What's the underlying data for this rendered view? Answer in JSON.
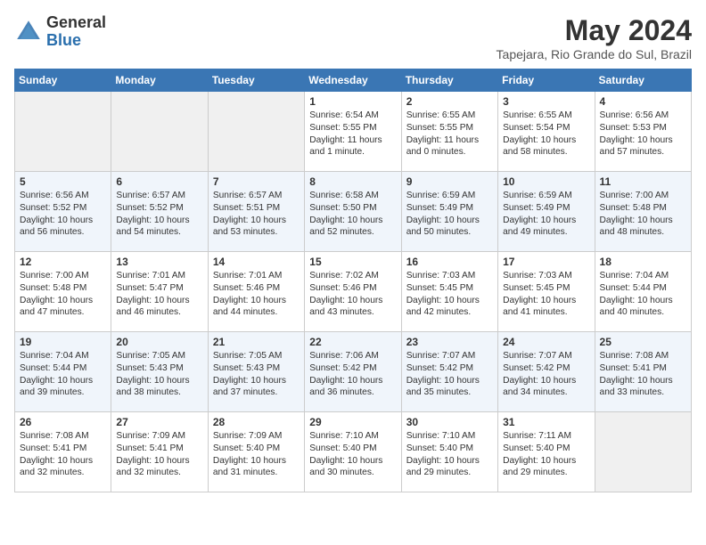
{
  "header": {
    "logo_text_general": "General",
    "logo_text_blue": "Blue",
    "month_title": "May 2024",
    "location": "Tapejara, Rio Grande do Sul, Brazil"
  },
  "days_of_week": [
    "Sunday",
    "Monday",
    "Tuesday",
    "Wednesday",
    "Thursday",
    "Friday",
    "Saturday"
  ],
  "weeks": [
    [
      {
        "day": "",
        "content": ""
      },
      {
        "day": "",
        "content": ""
      },
      {
        "day": "",
        "content": ""
      },
      {
        "day": "1",
        "content": "Sunrise: 6:54 AM\nSunset: 5:55 PM\nDaylight: 11 hours\nand 1 minute."
      },
      {
        "day": "2",
        "content": "Sunrise: 6:55 AM\nSunset: 5:55 PM\nDaylight: 11 hours\nand 0 minutes."
      },
      {
        "day": "3",
        "content": "Sunrise: 6:55 AM\nSunset: 5:54 PM\nDaylight: 10 hours\nand 58 minutes."
      },
      {
        "day": "4",
        "content": "Sunrise: 6:56 AM\nSunset: 5:53 PM\nDaylight: 10 hours\nand 57 minutes."
      }
    ],
    [
      {
        "day": "5",
        "content": "Sunrise: 6:56 AM\nSunset: 5:52 PM\nDaylight: 10 hours\nand 56 minutes."
      },
      {
        "day": "6",
        "content": "Sunrise: 6:57 AM\nSunset: 5:52 PM\nDaylight: 10 hours\nand 54 minutes."
      },
      {
        "day": "7",
        "content": "Sunrise: 6:57 AM\nSunset: 5:51 PM\nDaylight: 10 hours\nand 53 minutes."
      },
      {
        "day": "8",
        "content": "Sunrise: 6:58 AM\nSunset: 5:50 PM\nDaylight: 10 hours\nand 52 minutes."
      },
      {
        "day": "9",
        "content": "Sunrise: 6:59 AM\nSunset: 5:49 PM\nDaylight: 10 hours\nand 50 minutes."
      },
      {
        "day": "10",
        "content": "Sunrise: 6:59 AM\nSunset: 5:49 PM\nDaylight: 10 hours\nand 49 minutes."
      },
      {
        "day": "11",
        "content": "Sunrise: 7:00 AM\nSunset: 5:48 PM\nDaylight: 10 hours\nand 48 minutes."
      }
    ],
    [
      {
        "day": "12",
        "content": "Sunrise: 7:00 AM\nSunset: 5:48 PM\nDaylight: 10 hours\nand 47 minutes."
      },
      {
        "day": "13",
        "content": "Sunrise: 7:01 AM\nSunset: 5:47 PM\nDaylight: 10 hours\nand 46 minutes."
      },
      {
        "day": "14",
        "content": "Sunrise: 7:01 AM\nSunset: 5:46 PM\nDaylight: 10 hours\nand 44 minutes."
      },
      {
        "day": "15",
        "content": "Sunrise: 7:02 AM\nSunset: 5:46 PM\nDaylight: 10 hours\nand 43 minutes."
      },
      {
        "day": "16",
        "content": "Sunrise: 7:03 AM\nSunset: 5:45 PM\nDaylight: 10 hours\nand 42 minutes."
      },
      {
        "day": "17",
        "content": "Sunrise: 7:03 AM\nSunset: 5:45 PM\nDaylight: 10 hours\nand 41 minutes."
      },
      {
        "day": "18",
        "content": "Sunrise: 7:04 AM\nSunset: 5:44 PM\nDaylight: 10 hours\nand 40 minutes."
      }
    ],
    [
      {
        "day": "19",
        "content": "Sunrise: 7:04 AM\nSunset: 5:44 PM\nDaylight: 10 hours\nand 39 minutes."
      },
      {
        "day": "20",
        "content": "Sunrise: 7:05 AM\nSunset: 5:43 PM\nDaylight: 10 hours\nand 38 minutes."
      },
      {
        "day": "21",
        "content": "Sunrise: 7:05 AM\nSunset: 5:43 PM\nDaylight: 10 hours\nand 37 minutes."
      },
      {
        "day": "22",
        "content": "Sunrise: 7:06 AM\nSunset: 5:42 PM\nDaylight: 10 hours\nand 36 minutes."
      },
      {
        "day": "23",
        "content": "Sunrise: 7:07 AM\nSunset: 5:42 PM\nDaylight: 10 hours\nand 35 minutes."
      },
      {
        "day": "24",
        "content": "Sunrise: 7:07 AM\nSunset: 5:42 PM\nDaylight: 10 hours\nand 34 minutes."
      },
      {
        "day": "25",
        "content": "Sunrise: 7:08 AM\nSunset: 5:41 PM\nDaylight: 10 hours\nand 33 minutes."
      }
    ],
    [
      {
        "day": "26",
        "content": "Sunrise: 7:08 AM\nSunset: 5:41 PM\nDaylight: 10 hours\nand 32 minutes."
      },
      {
        "day": "27",
        "content": "Sunrise: 7:09 AM\nSunset: 5:41 PM\nDaylight: 10 hours\nand 32 minutes."
      },
      {
        "day": "28",
        "content": "Sunrise: 7:09 AM\nSunset: 5:40 PM\nDaylight: 10 hours\nand 31 minutes."
      },
      {
        "day": "29",
        "content": "Sunrise: 7:10 AM\nSunset: 5:40 PM\nDaylight: 10 hours\nand 30 minutes."
      },
      {
        "day": "30",
        "content": "Sunrise: 7:10 AM\nSunset: 5:40 PM\nDaylight: 10 hours\nand 29 minutes."
      },
      {
        "day": "31",
        "content": "Sunrise: 7:11 AM\nSunset: 5:40 PM\nDaylight: 10 hours\nand 29 minutes."
      },
      {
        "day": "",
        "content": ""
      }
    ]
  ]
}
